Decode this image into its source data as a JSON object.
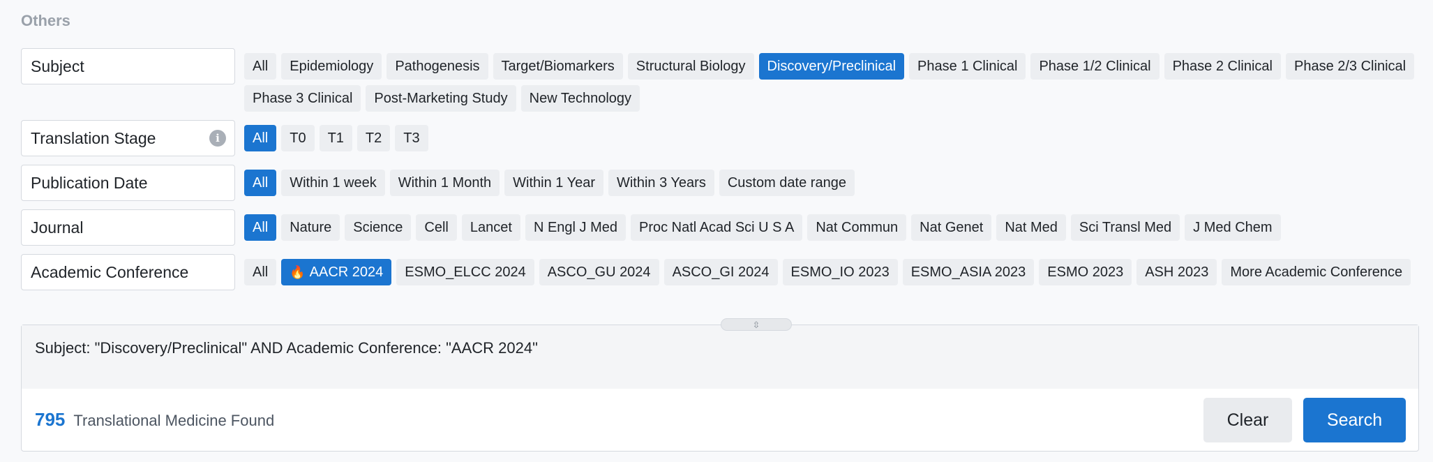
{
  "section_title": "Others",
  "filters": {
    "subject": {
      "label": "Subject",
      "options": [
        "All",
        "Epidemiology",
        "Pathogenesis",
        "Target/Biomarkers",
        "Structural Biology",
        "Discovery/Preclinical",
        "Phase 1 Clinical",
        "Phase 1/2 Clinical",
        "Phase 2 Clinical",
        "Phase 2/3 Clinical",
        "Phase 3 Clinical",
        "Post-Marketing Study",
        "New Technology"
      ],
      "selected": "Discovery/Preclinical"
    },
    "translation_stage": {
      "label": "Translation Stage",
      "info_icon": "info-icon",
      "options": [
        "All",
        "T0",
        "T1",
        "T2",
        "T3"
      ],
      "selected": "All"
    },
    "publication_date": {
      "label": "Publication Date",
      "options": [
        "All",
        "Within 1 week",
        "Within 1 Month",
        "Within 1 Year",
        "Within 3 Years",
        "Custom date range"
      ],
      "selected": "All"
    },
    "journal": {
      "label": "Journal",
      "options": [
        "All",
        "Nature",
        "Science",
        "Cell",
        "Lancet",
        "N Engl J Med",
        "Proc Natl Acad Sci U S A",
        "Nat Commun",
        "Nat Genet",
        "Nat Med",
        "Sci Transl Med",
        "J Med Chem"
      ],
      "selected": "All"
    },
    "academic_conference": {
      "label": "Academic Conference",
      "options": [
        "All",
        "AACR 2024",
        "ESMO_ELCC 2024",
        "ASCO_GU 2024",
        "ASCO_GI 2024",
        "ESMO_IO 2023",
        "ESMO_ASIA 2023",
        "ESMO 2023",
        "ASH 2023",
        "More Academic Conference"
      ],
      "selected": "AACR 2024",
      "hot_option": "AACR 2024",
      "hot_icon": "🔥"
    }
  },
  "query": {
    "text": "Subject: \"Discovery/Preclinical\" AND Academic Conference: \"AACR 2024\"",
    "resize_icon": "⇳"
  },
  "results": {
    "count": "795",
    "label": "Translational Medicine Found"
  },
  "buttons": {
    "clear": "Clear",
    "search": "Search"
  },
  "colors": {
    "accent": "#1b75d0",
    "tag_bg": "#eceef1",
    "page_bg": "#f8f9fb"
  }
}
